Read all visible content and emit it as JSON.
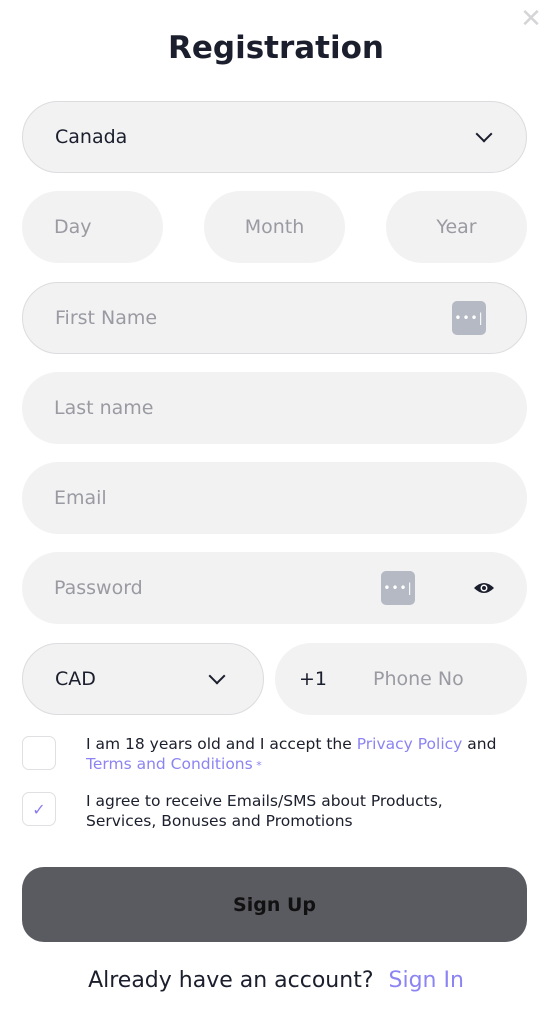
{
  "title": "Registration",
  "country": {
    "value": "Canada"
  },
  "dob": {
    "day_placeholder": "Day",
    "month_placeholder": "Month",
    "year_placeholder": "Year"
  },
  "first_name": {
    "placeholder": "First Name"
  },
  "last_name": {
    "placeholder": "Last name"
  },
  "email": {
    "placeholder": "Email"
  },
  "password": {
    "placeholder": "Password"
  },
  "currency": {
    "value": "CAD"
  },
  "phone": {
    "prefix": "+1",
    "placeholder": "Phone No"
  },
  "terms": {
    "text_before": "I am 18 years old and I accept the ",
    "privacy_link": "Privacy Policy",
    "and": " and ",
    "terms_link": "Terms and Conditions",
    "required_mark": " *",
    "checked": false
  },
  "marketing": {
    "text": "I agree to receive Emails/SMS about Products, Services, Bonuses and Promotions",
    "checked": true
  },
  "signup_button": "Sign Up",
  "footer": {
    "question": "Already have an account?",
    "signin_link": "Sign In"
  },
  "colors": {
    "accent": "#8c84f2",
    "button": "#5a5b60",
    "field": "#f2f2f3"
  }
}
